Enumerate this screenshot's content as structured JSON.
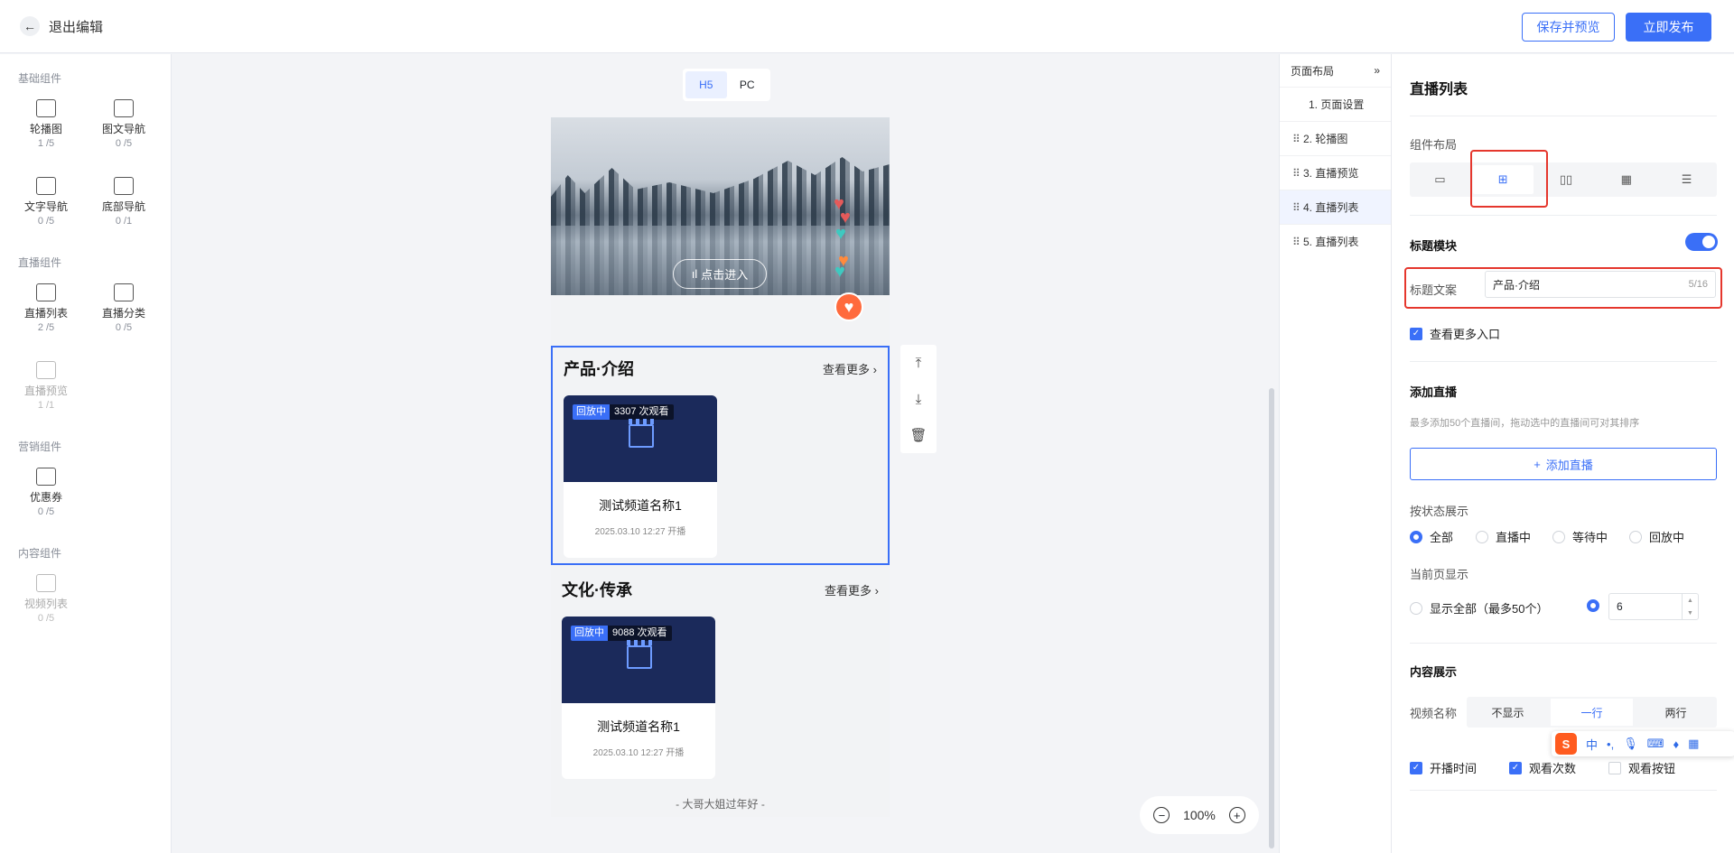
{
  "topbar": {
    "back_label": "退出编辑",
    "save_preview": "保存并预览",
    "publish": "立即发布"
  },
  "left_panel": {
    "groups": [
      {
        "title": "基础组件",
        "items": [
          {
            "name": "轮播图",
            "count": "1 /5"
          },
          {
            "name": "图文导航",
            "count": "0 /5"
          },
          {
            "name": "文字导航",
            "count": "0 /5"
          },
          {
            "name": "底部导航",
            "count": "0 /1"
          }
        ]
      },
      {
        "title": "直播组件",
        "items": [
          {
            "name": "直播列表",
            "count": "2 /5"
          },
          {
            "name": "直播分类",
            "count": "0 /5"
          },
          {
            "name": "直播预览",
            "count": "1 /1"
          }
        ]
      },
      {
        "title": "营销组件",
        "items": [
          {
            "name": "优惠券",
            "count": "0 /5"
          }
        ]
      },
      {
        "title": "内容组件",
        "items": [
          {
            "name": "视频列表",
            "count": "0 /5"
          }
        ]
      }
    ]
  },
  "canvas": {
    "device_tabs": [
      "H5",
      "PC"
    ],
    "enter_button": "点击进入",
    "sections": [
      {
        "title": "产品·介绍",
        "more": "查看更多",
        "card": {
          "status": "回放中",
          "views": "3307 次观看",
          "name": "测试频道名称1",
          "time": "2025.03.10 12:27 开播"
        }
      },
      {
        "title": "文化·传承",
        "more": "查看更多",
        "card": {
          "status": "回放中",
          "views": "9088 次观看",
          "name": "测试频道名称1",
          "time": "2025.03.10 12:27 开播"
        }
      }
    ],
    "footer": "- 大哥大姐过年好 -",
    "zoom": "100%"
  },
  "layout_list": {
    "title": "页面布局",
    "items": [
      "1. 页面设置",
      "2. 轮播图",
      "3. 直播预览",
      "4. 直播列表",
      "5. 直播列表"
    ]
  },
  "props": {
    "title": "直播列表",
    "layout_label": "组件布局",
    "title_module": "标题模块",
    "title_text_label": "标题文案",
    "title_text_value": "产品·介绍",
    "title_text_count": "5/16",
    "see_more": "查看更多入口",
    "add_live_title": "添加直播",
    "add_live_hint": "最多添加50个直播间，拖动选中的直播间可对其排序",
    "add_live_button": "添加直播",
    "status_label": "按状态展示",
    "status_options": [
      "全部",
      "直播中",
      "等待中",
      "回放中"
    ],
    "current_page_label": "当前页显示",
    "show_all": "显示全部（最多50个）",
    "page_count": "6",
    "content_title": "内容展示",
    "video_name_label": "视频名称",
    "video_name_options": [
      "不显示",
      "一行",
      "两行"
    ],
    "checkboxes": [
      "开播时间",
      "观看次数",
      "观看按钮"
    ],
    "ime_label": "中"
  },
  "colors": {
    "primary": "#3a6ff7",
    "highlight": "#e5372d",
    "card_bg": "#1b2a5b"
  }
}
